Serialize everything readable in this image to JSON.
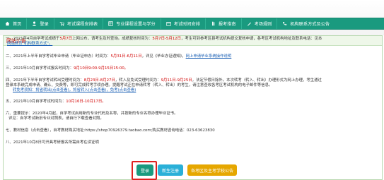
{
  "nav": {
    "items": [
      {
        "label": "首页",
        "icon": "home-icon"
      },
      {
        "label": "登录",
        "icon": "user-icon"
      },
      {
        "label": "考试课程安排表",
        "icon": "cart-icon"
      },
      {
        "label": "专业课程设置与学分",
        "icon": "grid-icon"
      },
      {
        "label": "考试时间安排",
        "icon": "calendar-icon"
      },
      {
        "label": "报考指南",
        "icon": "book-icon"
      },
      {
        "label": "考场规则",
        "icon": "pen-icon"
      },
      {
        "label": "机构联系方式及公告",
        "icon": "phone-icon"
      }
    ]
  },
  "panel": {
    "title": "网站公告"
  },
  "notice": {
    "l1a": "一、2021年4月自学考试成绩于",
    "l1b": "5月7日",
    "l1c": "上网公布，请考生及时查询。成绩复核时间为：",
    "l1d": "5月7日-5月12日",
    "l1e": "，考生可到参考区县考试机构提交复核申请，各考区考试机构地址及联系电话：见本",
    "l1f": "网站首页\"机构联系方式\"。",
    "l2a": "二、2021年上半年自学考试毕业申请（毕业证申办）时间为：",
    "l2b": "5月31日-6月11日",
    "l2c": "，详见《毕业办证通知》，",
    "l2d": "网上申请毕业系统操作说明",
    "l3a": "三、2021年10月自学考试报名时间为：",
    "l3b": "9月10日9:00-9月15日15:00。",
    "l4a": "四、2021年下半年自学考试转出受理时间为：",
    "l4b": "8月23日-8月27日",
    "l4c": "，转入及免试受理时间为：",
    "l4d": "9月11日-9月25日",
    "l4e": "，法定节假日除外。本次转考（转入、转出）办理形式为网上办理，考生通过",
    "l4f": "登录本系统完成申请、确认、交费等，即可完成转考手续办理。提醒考试正在申请转考（转入、转出）的考生，请注意查收各考区考试机构的电子邮件等信息。",
    "l4g": "转免考须知：将省转出(点击查看)，将省转入(点击查看)，免考(点击查看)",
    "l5a": "五、2021年10月自学考试时间为：",
    "l5b": "10月16日-10月17日。",
    "l6a": "六、重要提示：2020年4月起，自学考试启用新的专业代码及名称，并按新的专业名称办理毕业证书。",
    "l6b": "详见：自学考试新旧专业对照表，请自行下载查看对照。",
    "l7a": "七、教材信息（点击查看），自考教材购买地址:https://shop70926379.taobao.com;购买教材咨询电话：",
    "l7b": "023-63623830",
    "l8a": "八、2021年10月8日可开具考研报名所需自考在读证明"
  },
  "buttons": {
    "login": "登录",
    "register": "新生注册",
    "school": "各考区及主考学校公告"
  },
  "colors": {
    "nav_bg": "#1a9a7f",
    "accent_red": "#d10000",
    "link_blue": "#1a5fb4",
    "btn_register": "#2ab0d8",
    "btn_school": "#e6a700"
  }
}
